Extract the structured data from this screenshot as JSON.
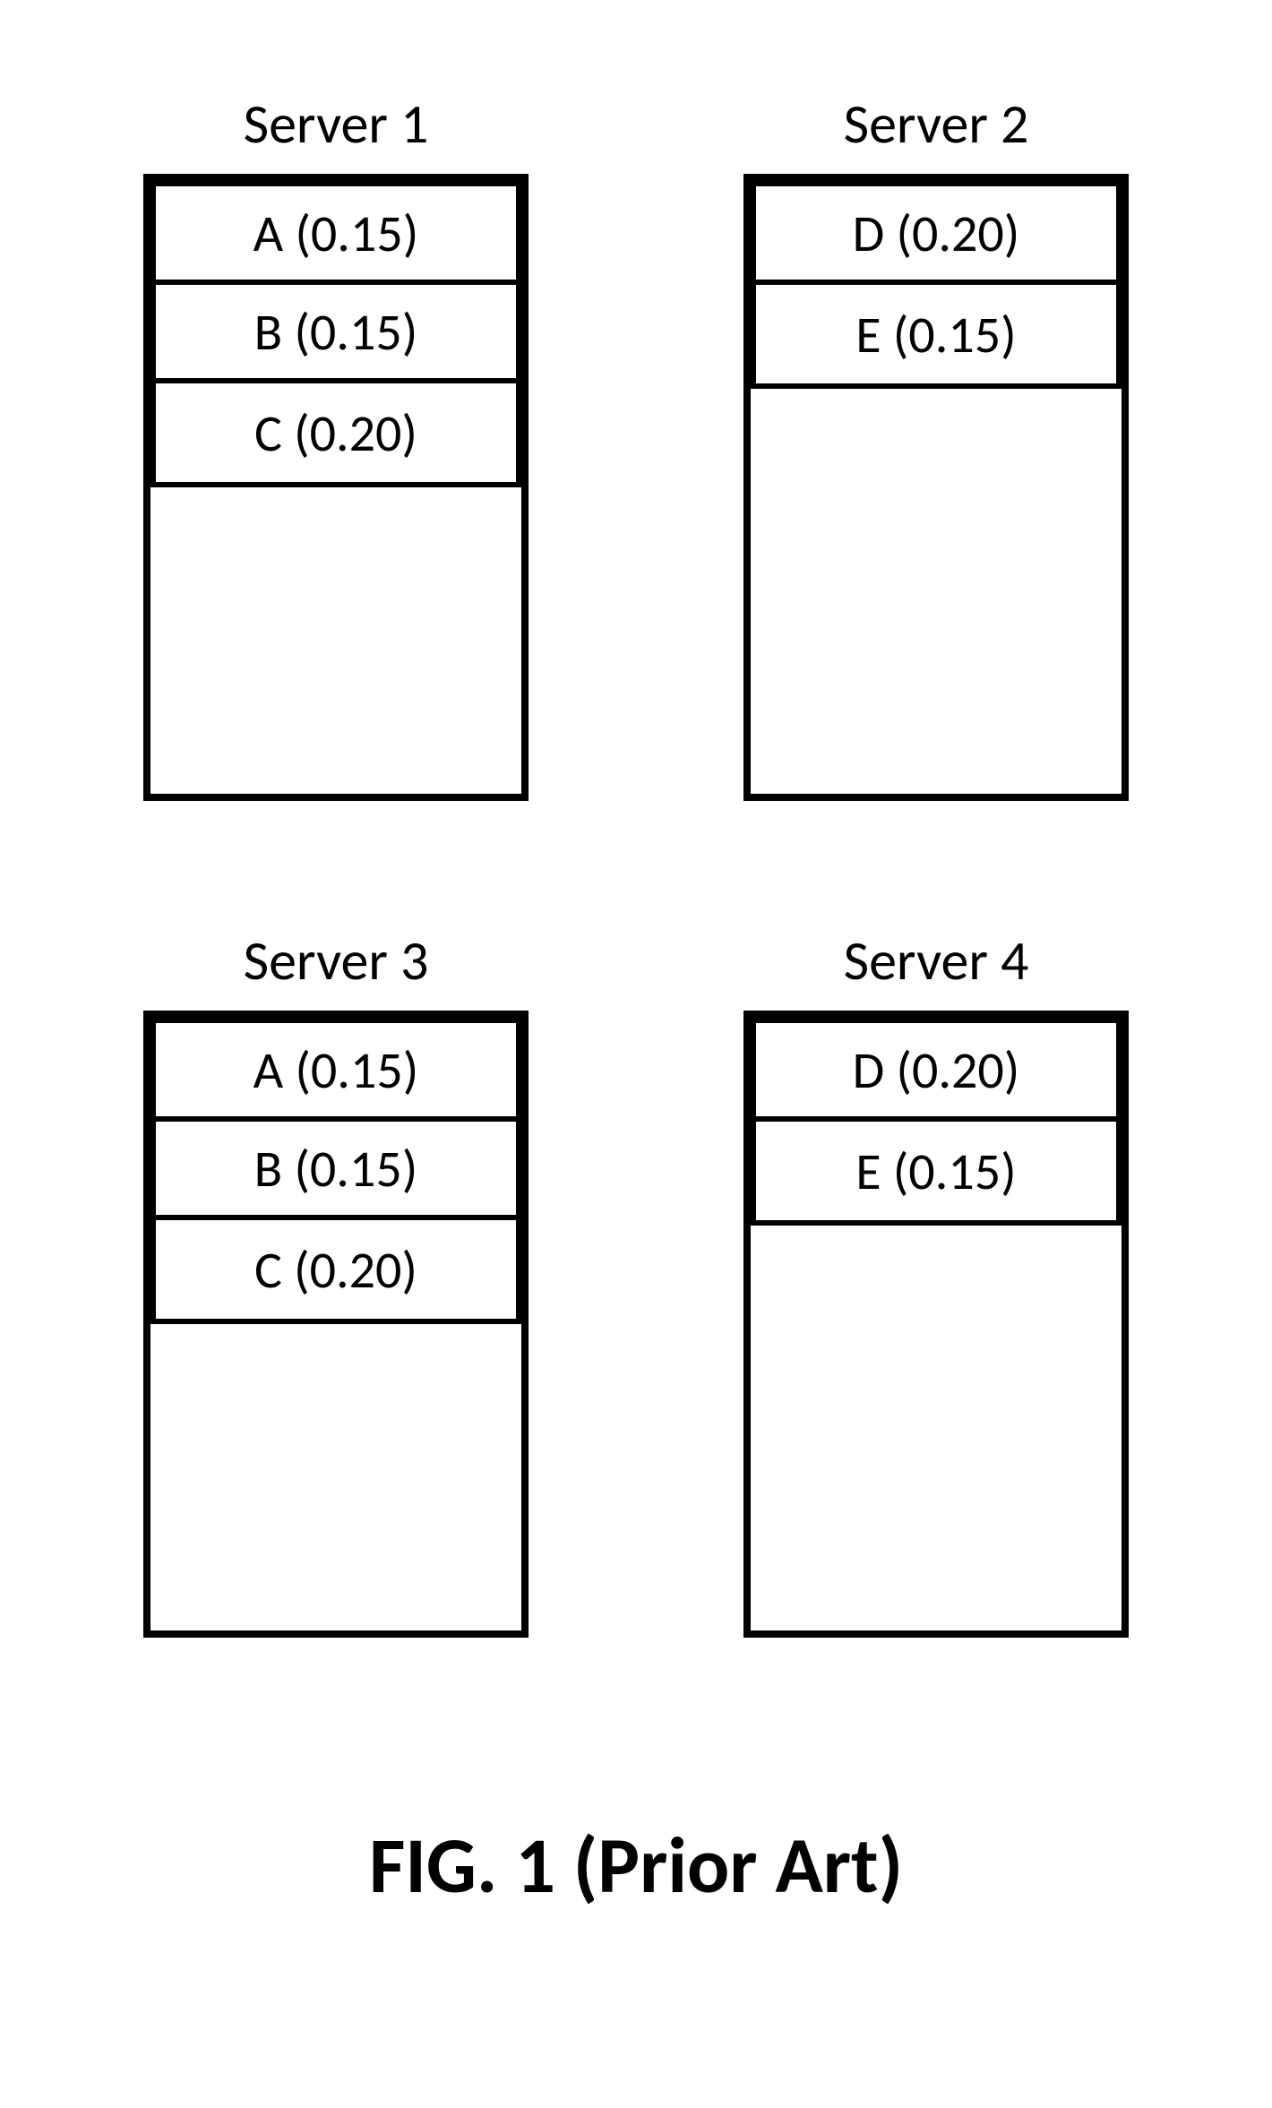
{
  "chart_data": {
    "type": "table",
    "title": "FIG. 1 (Prior Art)",
    "servers": [
      {
        "name": "Server 1",
        "items": [
          {
            "label": "A",
            "value": 0.15
          },
          {
            "label": "B",
            "value": 0.15
          },
          {
            "label": "C",
            "value": 0.2
          }
        ]
      },
      {
        "name": "Server 2",
        "items": [
          {
            "label": "D",
            "value": 0.2
          },
          {
            "label": "E",
            "value": 0.15
          }
        ]
      },
      {
        "name": "Server 3",
        "items": [
          {
            "label": "A",
            "value": 0.15
          },
          {
            "label": "B",
            "value": 0.15
          },
          {
            "label": "C",
            "value": 0.2
          }
        ]
      },
      {
        "name": "Server 4",
        "items": [
          {
            "label": "D",
            "value": 0.2
          },
          {
            "label": "E",
            "value": 0.15
          }
        ]
      }
    ]
  },
  "servers": {
    "0": {
      "title": "Server 1",
      "rows": {
        "0": "A (0.15)",
        "1": "B (0.15)",
        "2": "C (0.20)"
      }
    },
    "1": {
      "title": "Server 2",
      "rows": {
        "0": "D (0.20)",
        "1": "E (0.15)"
      }
    },
    "2": {
      "title": "Server 3",
      "rows": {
        "0": "A (0.15)",
        "1": "B (0.15)",
        "2": "C (0.20)"
      }
    },
    "3": {
      "title": "Server 4",
      "rows": {
        "0": "D (0.20)",
        "1": "E (0.15)"
      }
    }
  },
  "caption": "FIG. 1 (Prior Art)"
}
